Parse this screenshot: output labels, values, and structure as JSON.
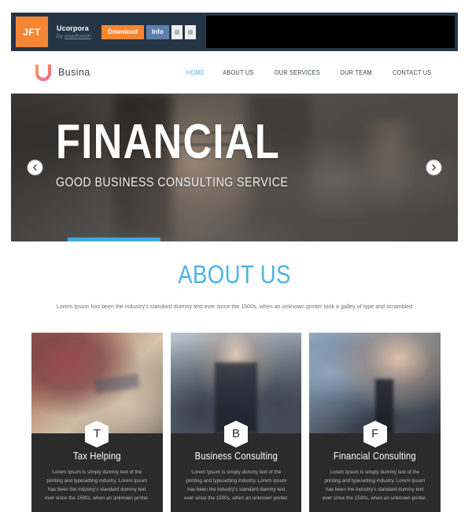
{
  "preview_bar": {
    "logo_text": "JFT",
    "item_title": "Ucorpora",
    "author_prefix": "by",
    "author_name": "asadswan",
    "download_label": "Download",
    "info_label": "Info",
    "accent_orange": "#f58634",
    "accent_blue": "#5b82ad",
    "bar_background": "#253546"
  },
  "site_header": {
    "brand_name": "Busina",
    "brand_mark": "u-logo-icon",
    "nav": [
      {
        "label": "HOME",
        "active": true
      },
      {
        "label": "ABOUT US",
        "active": false
      },
      {
        "label": "OUR SERVICES",
        "active": false
      },
      {
        "label": "OUR TEAM",
        "active": false
      },
      {
        "label": "CONTACT US",
        "active": false
      }
    ]
  },
  "hero": {
    "title": "FINANCIAL",
    "subtitle": "GOOD BUSINESS CONSULTING SERVICE",
    "prev_icon": "chevron-left-icon",
    "next_icon": "chevron-right-icon",
    "progress_color": "#3fa9e0"
  },
  "about": {
    "title": "ABOUT US",
    "title_color": "#4db2e8",
    "description": "Lorem Ipsum has been the industry's standard dummy text ever since the 1500s, when an unknown printer took a galley of type and scrambled"
  },
  "services": {
    "cards": [
      {
        "badge": "T",
        "title": "Tax Helping",
        "text": "Lorem Ipsum is simply dummy text of the printing and typesetting industry. Lorem Ipsum has been the industry's standard dummy text ever since the 1500s, when an unknown printer."
      },
      {
        "badge": "B",
        "title": "Business Consulting",
        "text": "Lorem Ipsum is simply dummy text of the printing and typesetting industry. Lorem Ipsum has been the industry's standard dummy text ever since the 1500s, when an unknown printer."
      },
      {
        "badge": "F",
        "title": "Financial Consulting",
        "text": "Lorem Ipsum is simply dummy text of the printing and typesetting industry. Lorem Ipsum has been the industry's standard dummy text ever since the 1500s, when an unknown printer."
      }
    ]
  }
}
